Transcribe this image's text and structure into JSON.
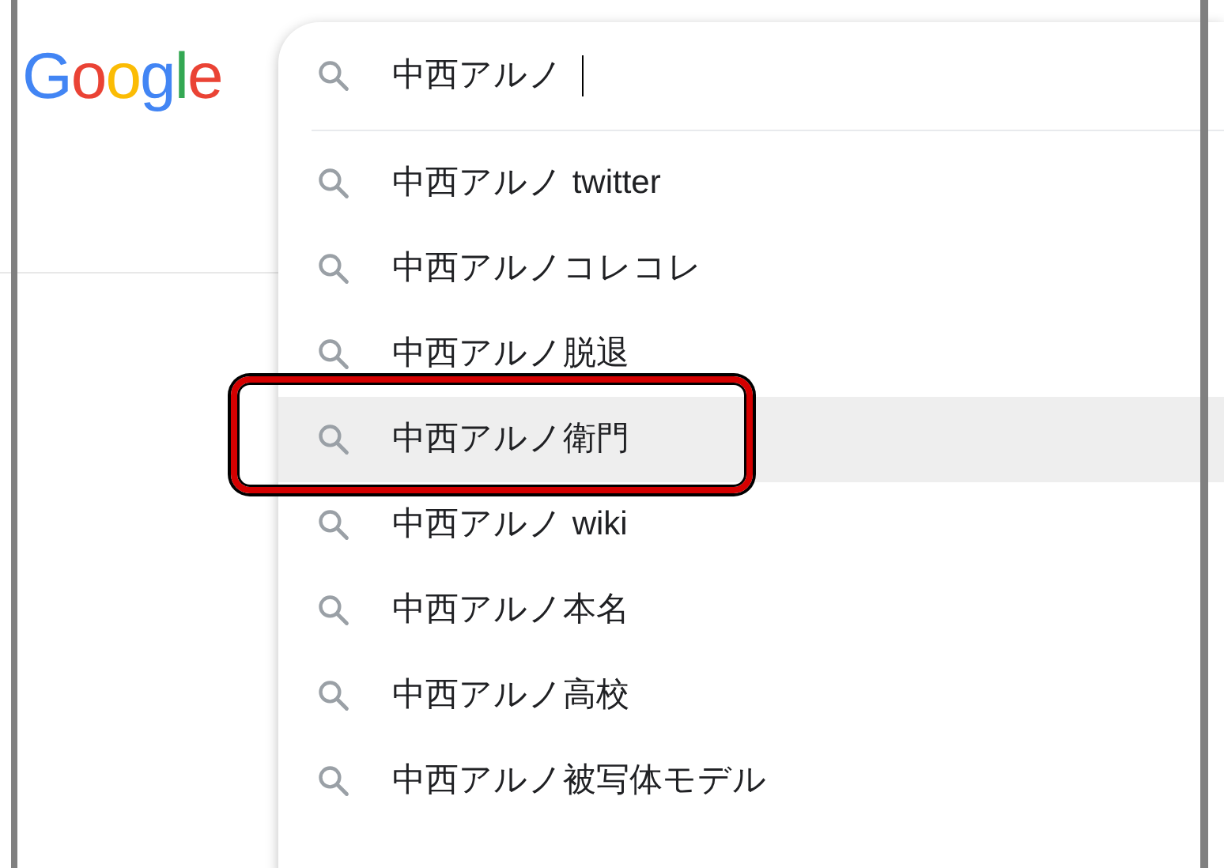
{
  "logo": "Google",
  "search": {
    "value": "中西アルノ",
    "focused": true
  },
  "suggestions": [
    {
      "text": "中西アルノ twitter",
      "selected": false,
      "annotated": false
    },
    {
      "text": "中西アルノコレコレ",
      "selected": false,
      "annotated": false
    },
    {
      "text": "中西アルノ脱退",
      "selected": false,
      "annotated": false
    },
    {
      "text": "中西アルノ衛門",
      "selected": true,
      "annotated": true
    },
    {
      "text": "中西アルノ wiki",
      "selected": false,
      "annotated": false
    },
    {
      "text": "中西アルノ本名",
      "selected": false,
      "annotated": false
    },
    {
      "text": "中西アルノ高校",
      "selected": false,
      "annotated": false
    },
    {
      "text": "中西アルノ被写体モデル",
      "selected": false,
      "annotated": false
    }
  ]
}
